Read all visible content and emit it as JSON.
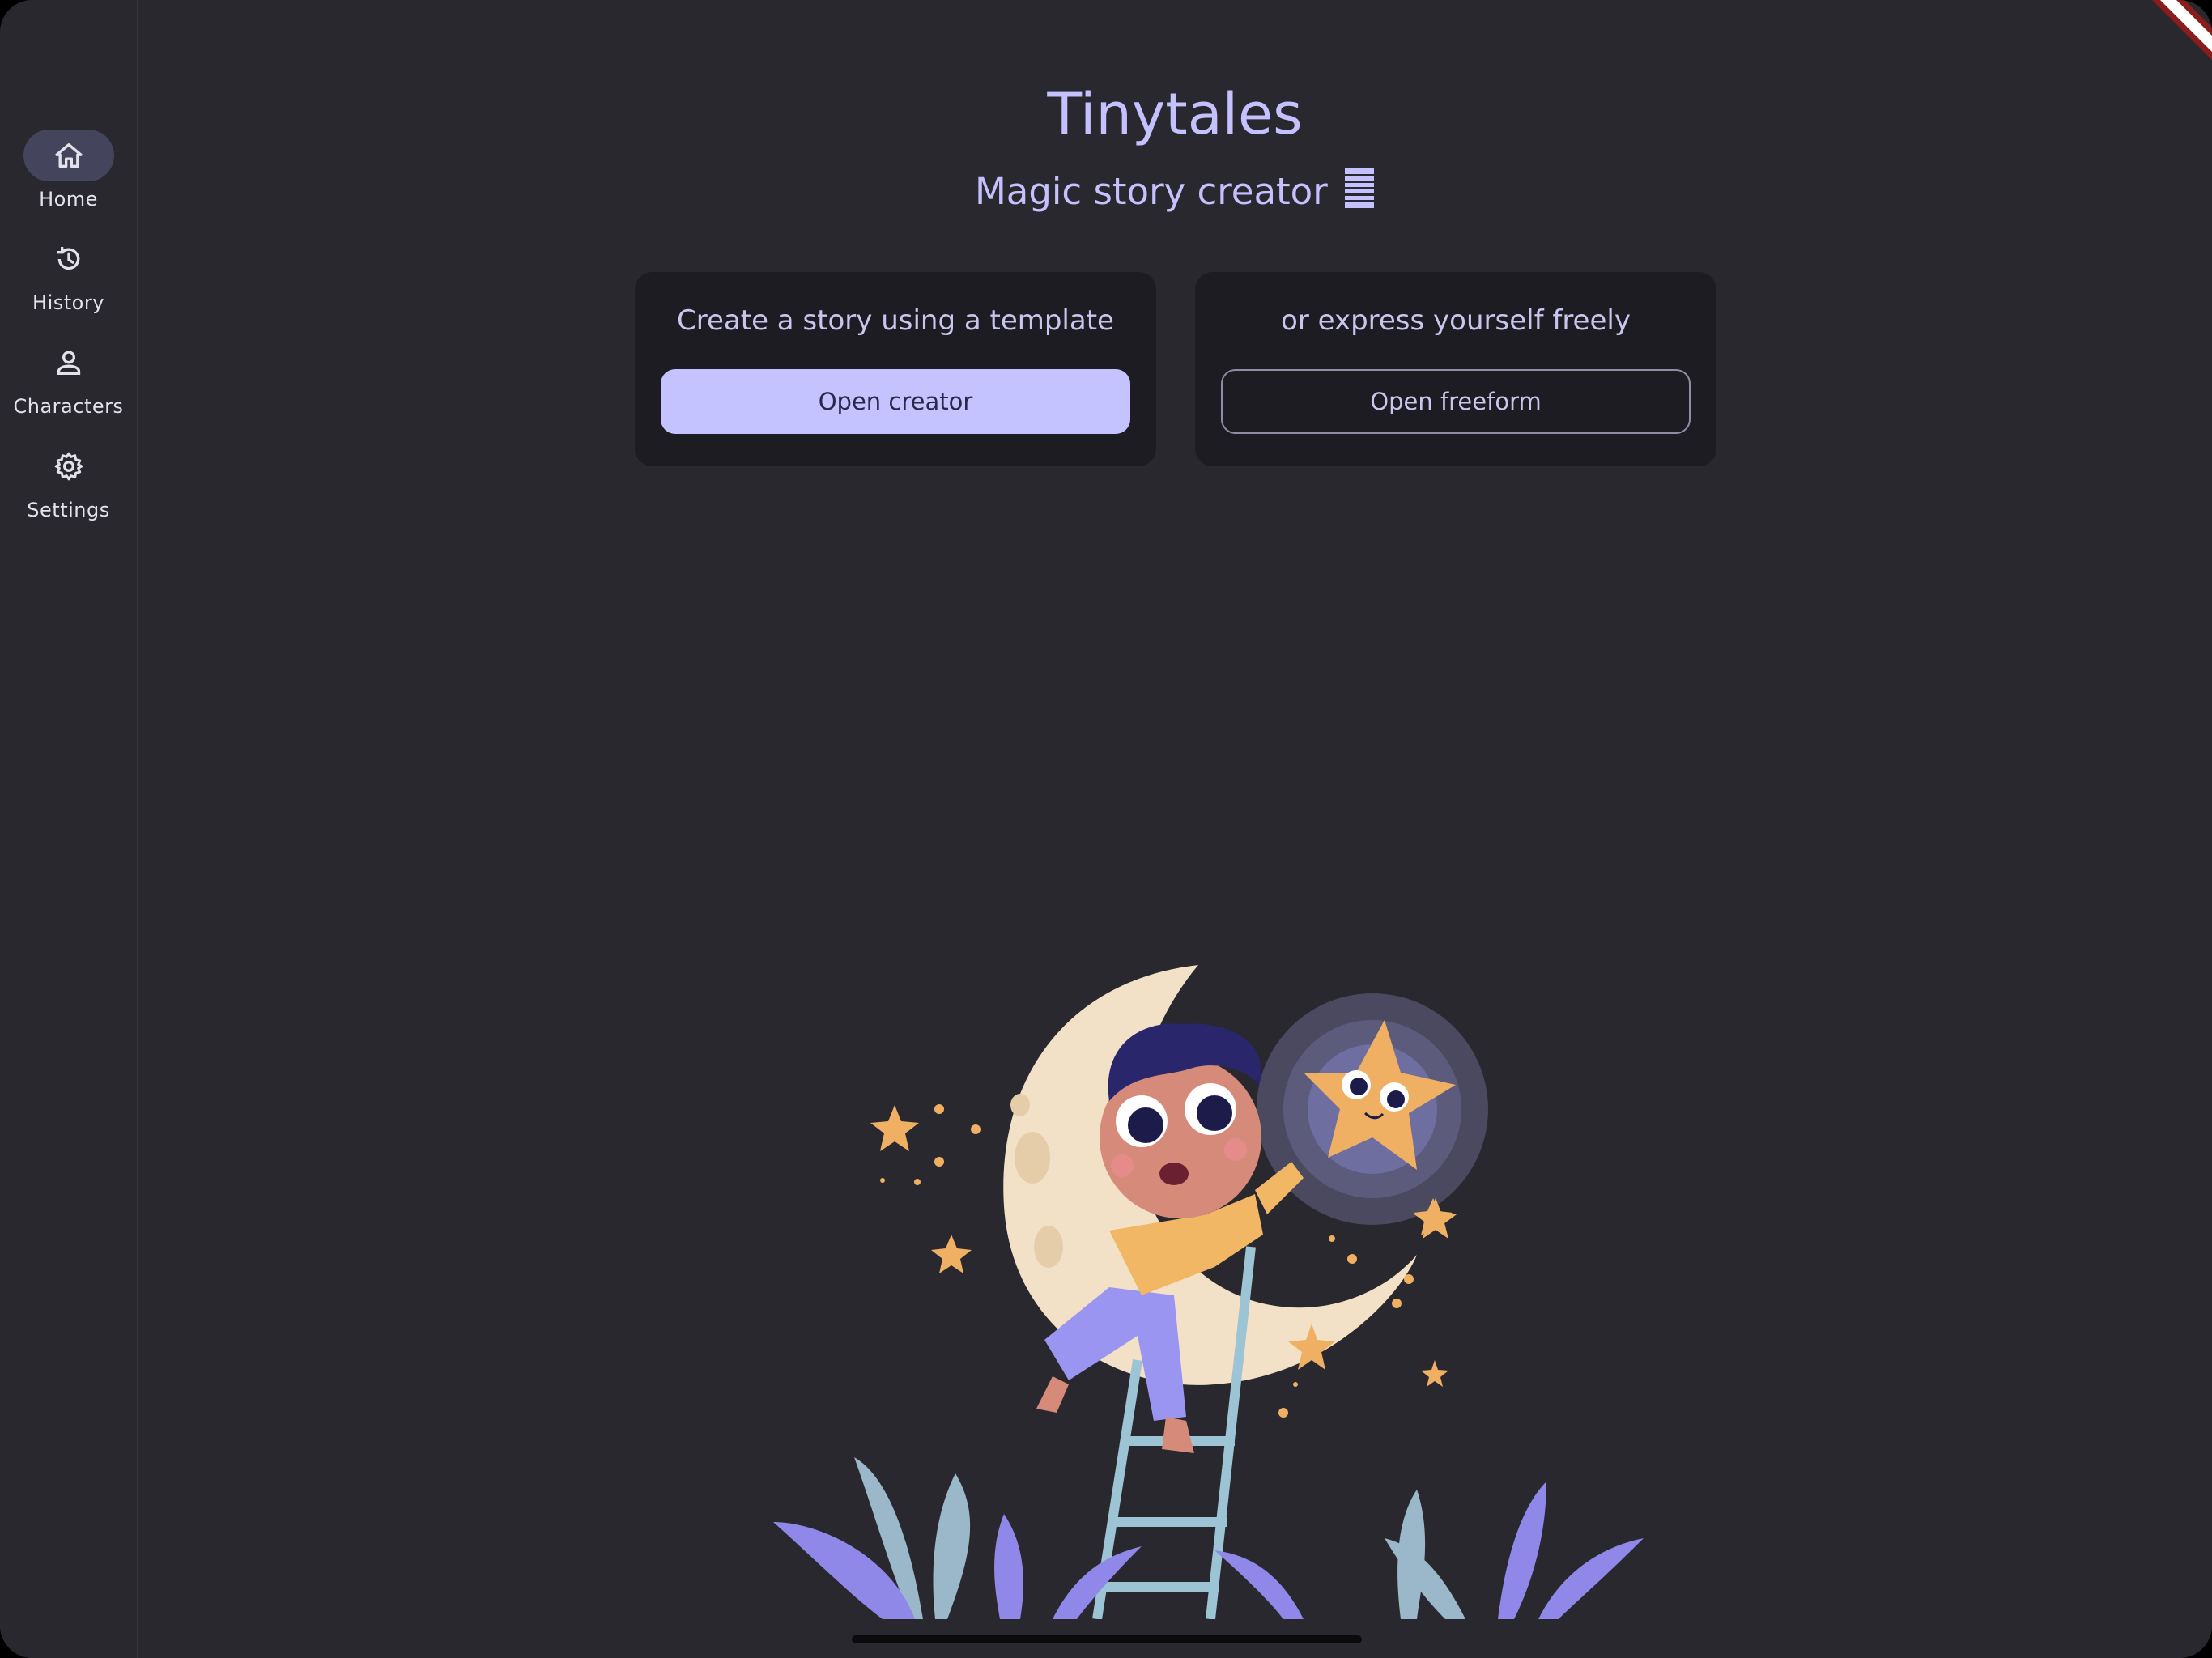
{
  "app": {
    "title": "Tinytales",
    "subtitle": "Magic story creator"
  },
  "sidebar": {
    "items": [
      {
        "label": "Home",
        "icon": "home-icon",
        "active": true
      },
      {
        "label": "History",
        "icon": "history-icon",
        "active": false
      },
      {
        "label": "Characters",
        "icon": "person-icon",
        "active": false
      },
      {
        "label": "Settings",
        "icon": "gear-icon",
        "active": false
      }
    ]
  },
  "cards": {
    "template": {
      "text": "Create a story using a template",
      "button": "Open creator"
    },
    "freeform": {
      "text": "or express yourself freely",
      "button": "Open freeform"
    }
  },
  "colors": {
    "background": "#29282f",
    "accent": "#c5c3ff",
    "card": "#1d1c22",
    "active_nav": "#44455c"
  }
}
